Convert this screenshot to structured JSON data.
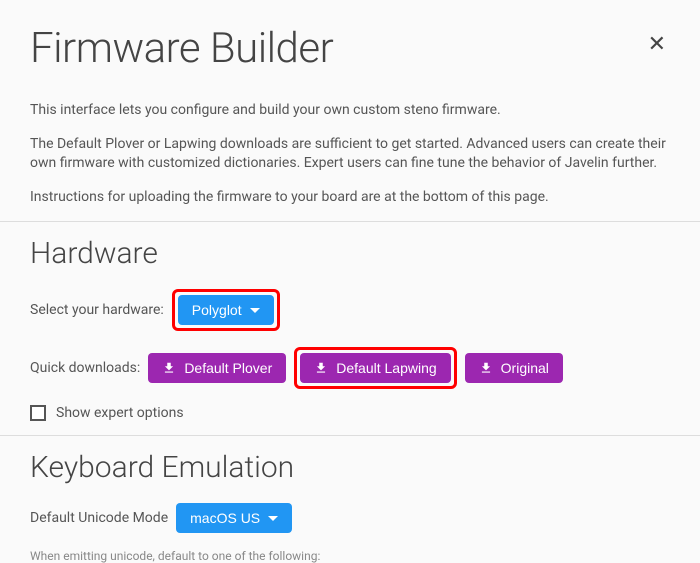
{
  "title": "Firmware Builder",
  "intro": {
    "p1": "This interface lets you configure and build your own custom steno firmware.",
    "p2": "The Default Plover or Lapwing downloads are sufficient to get started. Advanced users can create their own firmware with customized dictionaries. Expert users can fine tune the behavior of Javelin further.",
    "p3": "Instructions for uploading the firmware to your board are at the bottom of this page."
  },
  "hardware": {
    "heading": "Hardware",
    "select_label": "Select your hardware:",
    "select_value": "Polyglot",
    "quick_label": "Quick downloads:",
    "btn_plover": "Default Plover",
    "btn_lapwing": "Default Lapwing",
    "btn_original": "Original",
    "expert_label": "Show expert options"
  },
  "keyboard": {
    "heading": "Keyboard Emulation",
    "unicode_label": "Default Unicode Mode",
    "unicode_value": "macOS US",
    "unicode_hint": "When emitting unicode, default to one of the following:"
  }
}
